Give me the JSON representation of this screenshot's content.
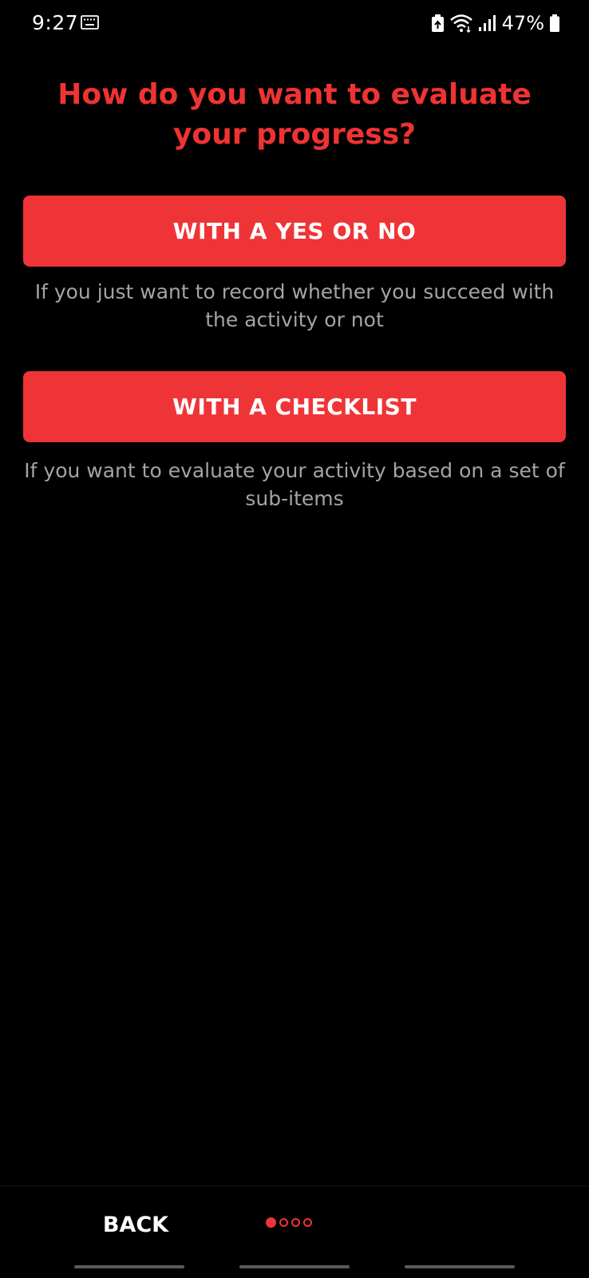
{
  "status_bar": {
    "time": "9:27",
    "battery_percent": "47%",
    "icons": [
      "keyboard-icon",
      "battery-saver-icon",
      "wifi-icon",
      "signal-icon",
      "battery-icon"
    ]
  },
  "title": "How do you want to evaluate your progress?",
  "options": [
    {
      "label": "WITH A YES OR NO",
      "description": "If you just want to record whether you succeed with the activity or not"
    },
    {
      "label": "WITH A CHECKLIST",
      "description": "If you want to evaluate your activity based on a set of sub-items"
    }
  ],
  "bottom_nav": {
    "back_label": "BACK",
    "page_indicator": {
      "current_page": 1,
      "total_pages": 4
    }
  },
  "colors": {
    "accent": "#ef3437",
    "background": "#000000",
    "description_text": "#a4a4a4"
  }
}
